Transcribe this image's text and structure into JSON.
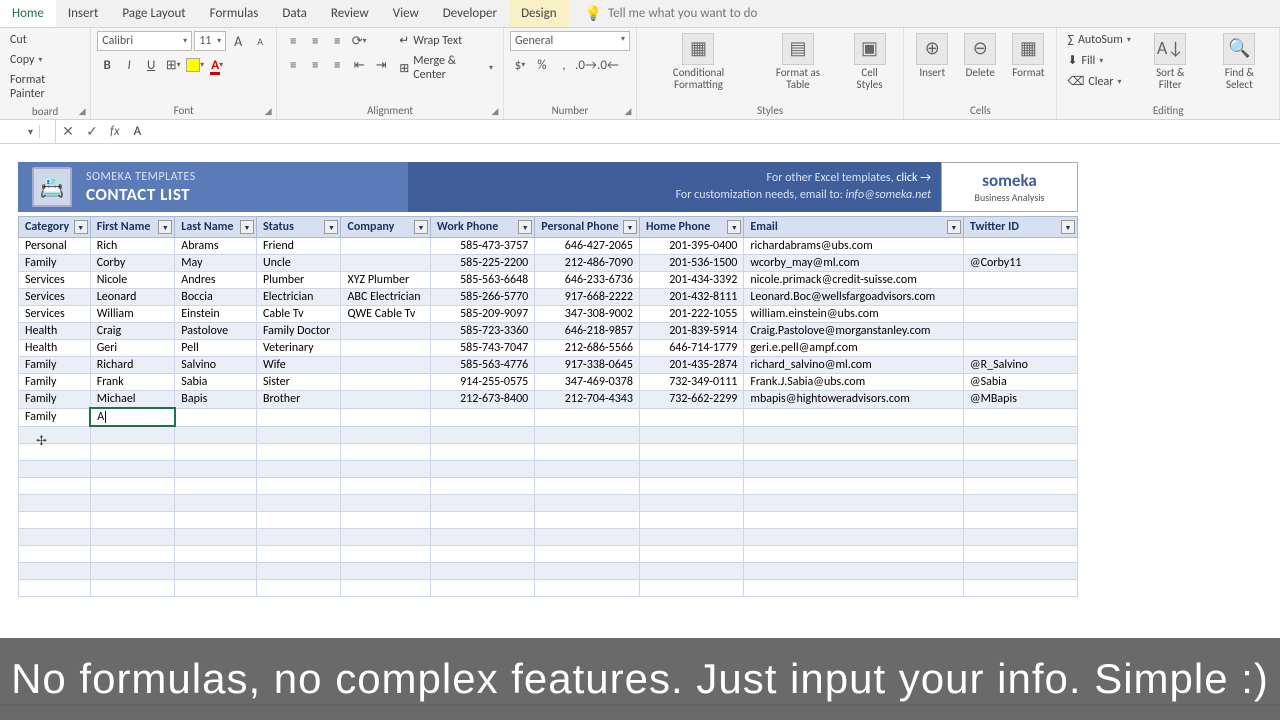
{
  "tabs": {
    "home": "Home",
    "insert": "Insert",
    "page_layout": "Page Layout",
    "formulas": "Formulas",
    "data": "Data",
    "review": "Review",
    "view": "View",
    "developer": "Developer",
    "design": "Design",
    "tellme": "Tell me what you want to do"
  },
  "clipboard": {
    "cut": "Cut",
    "copy": "Copy",
    "fmt": "Format Painter",
    "label": "board"
  },
  "font": {
    "name": "Calibri",
    "size": "11",
    "incA": "A",
    "decA": "A",
    "bold": "B",
    "italic": "I",
    "underline": "U",
    "label": "Font"
  },
  "alignment": {
    "wrap": "Wrap Text",
    "merge": "Merge & Center",
    "label": "Alignment"
  },
  "number": {
    "format": "General",
    "label": "Number"
  },
  "styles": {
    "cond": "Conditional Formatting",
    "table": "Format as Table",
    "cell": "Cell Styles",
    "label": "Styles"
  },
  "cells": {
    "insert": "Insert",
    "delete": "Delete",
    "format": "Format",
    "label": "Cells"
  },
  "editing": {
    "autosum": "AutoSum",
    "fill": "Fill",
    "clear": "Clear",
    "sort": "Sort & Filter",
    "find": "Find & Select",
    "label": "Editing"
  },
  "formula_bar": {
    "cancel": "✕",
    "enter": "✓",
    "fx": "fx",
    "value": "A"
  },
  "template": {
    "brand": "SOMEKA TEMPLATES",
    "title": "CONTACT LIST",
    "line1_a": "For other Excel templates, ",
    "line1_b": "click →",
    "line2_a": "For customization needs, email to: ",
    "line2_b": "info@someka.net",
    "badge_brand": "someka",
    "badge_tag": "Business Analysis"
  },
  "headers": {
    "cat": "Category",
    "fn": "First Name",
    "ln": "Last Name",
    "st": "Status",
    "co": "Company",
    "wp": "Work Phone",
    "pp": "Personal Phone",
    "hp": "Home Phone",
    "em": "Email",
    "tw": "Twitter ID"
  },
  "rows": [
    {
      "cat": "Personal",
      "fn": "Rich",
      "ln": "Abrams",
      "st": "Friend",
      "co": "",
      "wp": "585-473-3757",
      "pp": "646-427-2065",
      "hp": "201-395-0400",
      "em": "richardabrams@ubs.com",
      "tw": ""
    },
    {
      "cat": "Family",
      "fn": "Corby",
      "ln": "May",
      "st": "Uncle",
      "co": "",
      "wp": "585-225-2200",
      "pp": "212-486-7090",
      "hp": "201-536-1500",
      "em": "wcorby_may@ml.com",
      "tw": "@Corby11"
    },
    {
      "cat": "Services",
      "fn": "Nicole",
      "ln": "Andres",
      "st": "Plumber",
      "co": "XYZ Plumber",
      "wp": "585-563-6648",
      "pp": "646-233-6736",
      "hp": "201-434-3392",
      "em": "nicole.primack@credit-suisse.com",
      "tw": ""
    },
    {
      "cat": "Services",
      "fn": "Leonard",
      "ln": "Boccia",
      "st": "Electrician",
      "co": "ABC Electrician",
      "wp": "585-266-5770",
      "pp": "917-668-2222",
      "hp": "201-432-8111",
      "em": "Leonard.Boc@wellsfargoadvisors.com",
      "tw": ""
    },
    {
      "cat": "Services",
      "fn": "William",
      "ln": "Einstein",
      "st": "Cable Tv",
      "co": "QWE Cable Tv",
      "wp": "585-209-9097",
      "pp": "347-308-9002",
      "hp": "201-222-1055",
      "em": "william.einstein@ubs.com",
      "tw": ""
    },
    {
      "cat": "Health",
      "fn": "Craig",
      "ln": "Pastolove",
      "st": "Family Doctor",
      "co": "",
      "wp": "585-723-3360",
      "pp": "646-218-9857",
      "hp": "201-839-5914",
      "em": "Craig.Pastolove@morganstanley.com",
      "tw": ""
    },
    {
      "cat": "Health",
      "fn": "Geri",
      "ln": "Pell",
      "st": "Veterinary",
      "co": "",
      "wp": "585-743-7047",
      "pp": "212-686-5566",
      "hp": "646-714-1779",
      "em": "geri.e.pell@ampf.com",
      "tw": ""
    },
    {
      "cat": "Family",
      "fn": "Richard",
      "ln": "Salvino",
      "st": "Wife",
      "co": "",
      "wp": "585-563-4776",
      "pp": "917-338-0645",
      "hp": "201-435-2874",
      "em": "richard_salvino@ml.com",
      "tw": "@R_Salvino"
    },
    {
      "cat": "Family",
      "fn": "Frank",
      "ln": "Sabia",
      "st": "Sister",
      "co": "",
      "wp": "914-255-0575",
      "pp": "347-469-0378",
      "hp": "732-349-0111",
      "em": "Frank.J.Sabia@ubs.com",
      "tw": "@Sabia"
    },
    {
      "cat": "Family",
      "fn": "Michael",
      "ln": "Bapis",
      "st": "Brother",
      "co": "",
      "wp": "212-673-8400",
      "pp": "212-704-4343",
      "hp": "732-662-2299",
      "em": "mbapis@hightoweradvisors.com",
      "tw": "@MBapis"
    }
  ],
  "editing_row": {
    "cat": "Family",
    "fn": "A"
  },
  "caption": "No formulas, no complex features. Just input your info. Simple :)",
  "empty_rows": 10
}
